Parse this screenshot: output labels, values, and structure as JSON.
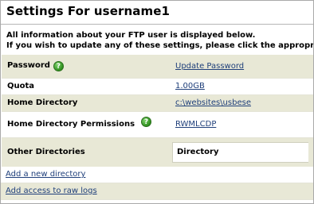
{
  "page": {
    "title": "Settings For username1",
    "intro_line1": "All information about your FTP user is displayed below.",
    "intro_line2": "If you wish to update any of these settings, please click the appropriat"
  },
  "help_icon_glyph": "?",
  "rows": {
    "password": {
      "label": "Password",
      "value": "Update Password"
    },
    "quota": {
      "label": "Quota",
      "value": "1.00GB"
    },
    "home_directory": {
      "label": "Home Directory",
      "value": "c:\\websites\\usbese"
    },
    "home_permissions": {
      "label": "Home Directory Permissions",
      "value": "RWMLCDP"
    },
    "other_directories": {
      "label": "Other Directories",
      "column_header": "Directory"
    }
  },
  "links": {
    "add_directory": "Add a new directory",
    "add_raw_logs": "Add access to raw logs"
  },
  "colors": {
    "row_tint": "#e8e8d6",
    "link": "#1f3f7a",
    "help_icon": "#2f8f1e"
  }
}
